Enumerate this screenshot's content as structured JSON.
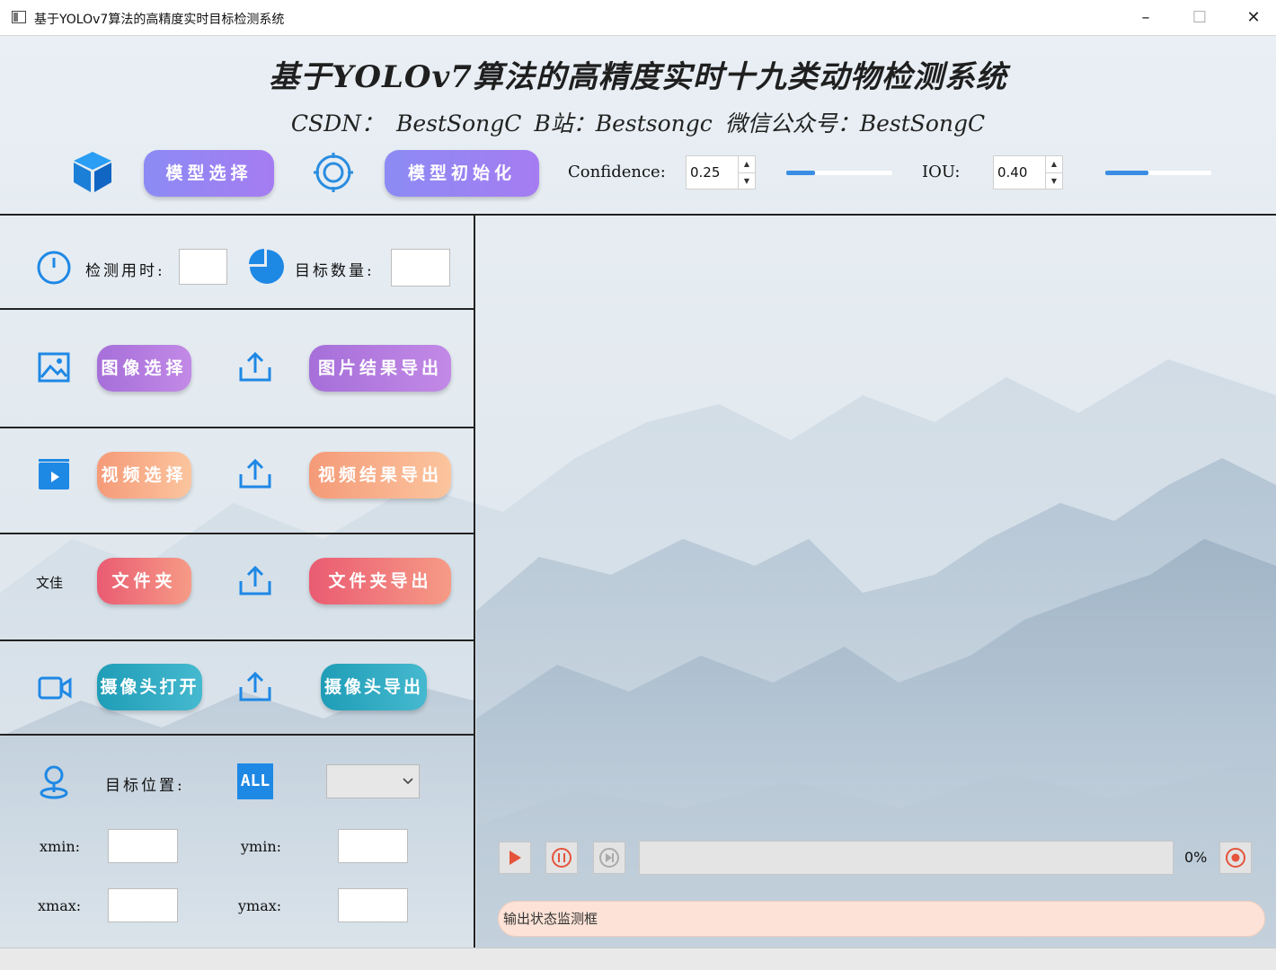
{
  "window": {
    "title": "基于YOLOv7算法的高精度实时目标检测系统",
    "minimize": "–",
    "maximize": "☐",
    "close": "✕"
  },
  "header": {
    "title": "基于YOLOv7算法的高精度实时十九类动物检测系统",
    "subtitle": "CSDN： BestSongC  B站：Bestsongc  微信公众号：BestSongC"
  },
  "toolbar": {
    "model_select": "模型选择",
    "model_init": "模型初始化",
    "confidence_label": "Confidence:",
    "confidence_value": "0.25",
    "confidence_slider": 0.25,
    "iou_label": "IOU:",
    "iou_value": "0.40",
    "iou_slider": 0.4
  },
  "stats": {
    "time_label": "检测用时:",
    "time_value": "",
    "count_label": "目标数量:",
    "count_value": ""
  },
  "actions": {
    "image_select": "图像选择",
    "image_export": "图片结果导出",
    "video_select": "视频选择",
    "video_export": "视频结果导出",
    "folder_prefix": "文佳",
    "folder_select": "文件夹",
    "folder_export": "文件夹导出",
    "camera_open": "摄像头打开",
    "camera_export": "摄像头导出"
  },
  "position": {
    "label": "目标位置:",
    "all_badge": "ALL",
    "select_value": "",
    "xmin_label": "xmin:",
    "ymin_label": "ymin:",
    "xmax_label": "xmax:",
    "ymax_label": "ymax:"
  },
  "player": {
    "progress_text": "0%",
    "progress": 0,
    "status_placeholder": "输出状态监测框"
  },
  "colors": {
    "accent_blue": "#3a8de4",
    "icon_blue": "#1e88e5",
    "play_red": "#e5533b"
  }
}
